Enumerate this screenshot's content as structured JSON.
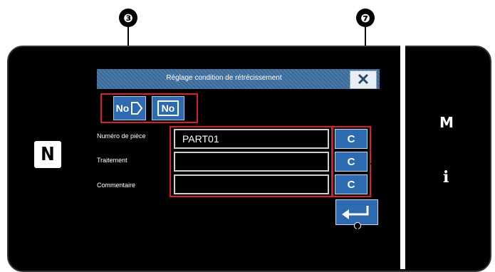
{
  "dialog": {
    "title": "Réglage condition de rétrécissement",
    "close_glyph": "✕"
  },
  "callouts": {
    "c3": "❸",
    "c7": "❼"
  },
  "side": {
    "nfc_glyph": "N",
    "m_label": "M",
    "i_label": "i"
  },
  "buttons": {
    "no_select": "No",
    "no_change": "No"
  },
  "fields": [
    {
      "label": "Numéro de pièce",
      "value": "PART01",
      "clear": "C"
    },
    {
      "label": "Traitement",
      "value": "",
      "clear": "C"
    },
    {
      "label": "Commentaire",
      "value": "",
      "clear": "C"
    }
  ],
  "colors": {
    "button_blue": "#2d6ab0",
    "highlight_red": "#d8202a",
    "titlebar_blue": "#4a7aa8"
  }
}
